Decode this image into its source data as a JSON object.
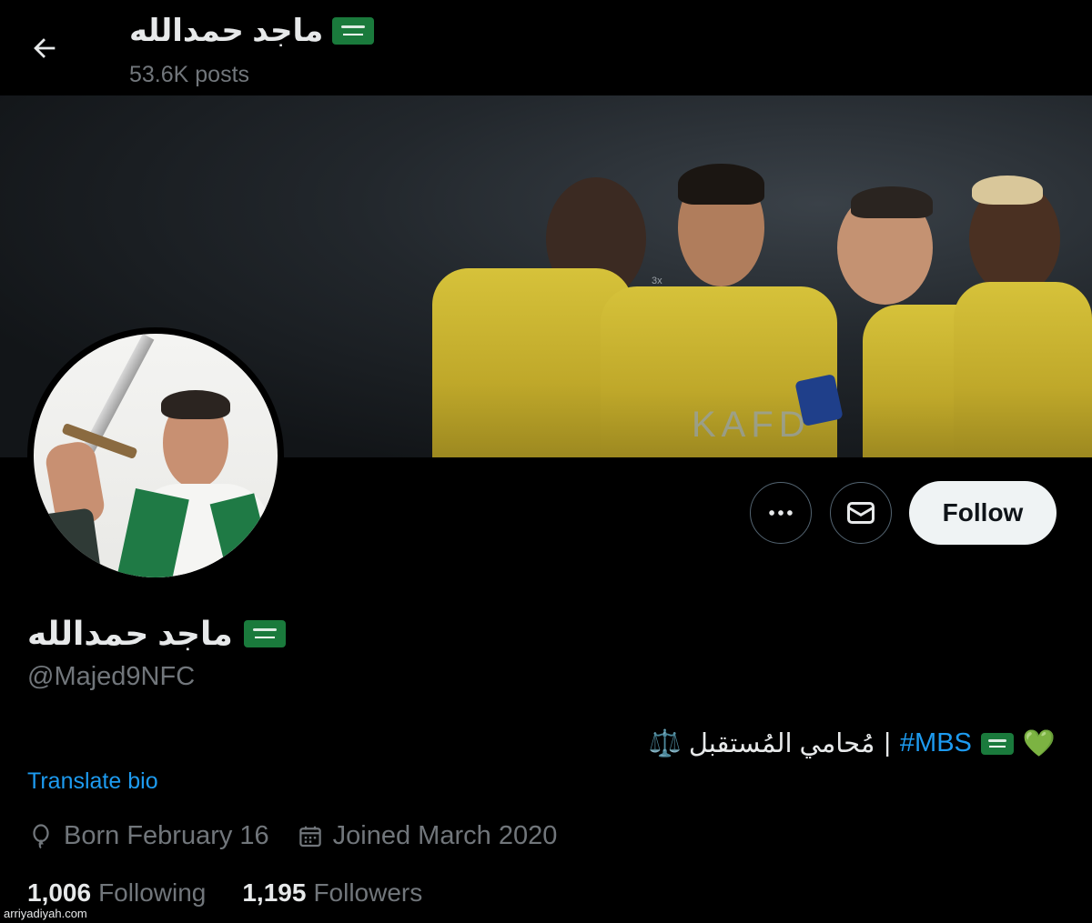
{
  "header": {
    "display_name": "ماجد حمدالله",
    "posts_count": "53.6K posts"
  },
  "banner": {
    "jersey_text": "KAFD",
    "small_text": "3x"
  },
  "actions": {
    "more_label": "More",
    "message_label": "Message",
    "follow_label": "Follow"
  },
  "profile": {
    "display_name": "ماجد حمدالله",
    "handle": "@Majed9NFC",
    "bio_text": "مُحامي المُستقبل ⚖️",
    "bio_hashtag": "#MBS",
    "bio_separator": "|",
    "heart": "💚",
    "translate_label": "Translate bio",
    "born": "Born February 16",
    "joined": "Joined March 2020",
    "following_count": "1,006",
    "following_label": "Following",
    "followers_count": "1,195",
    "followers_label": "Followers"
  },
  "watermark": "arriyadiyah.com",
  "colors": {
    "background": "#000000",
    "text": "#e7e9ea",
    "muted": "#71767b",
    "link": "#1d9bf0",
    "follow_bg": "#eff3f4",
    "flag_green": "#1a7a3c",
    "jersey_yellow": "#d6c23a"
  },
  "icons": [
    "back-arrow-icon",
    "more-icon",
    "mail-icon",
    "balloon-icon",
    "calendar-icon",
    "flag-icon",
    "heart-icon"
  ]
}
